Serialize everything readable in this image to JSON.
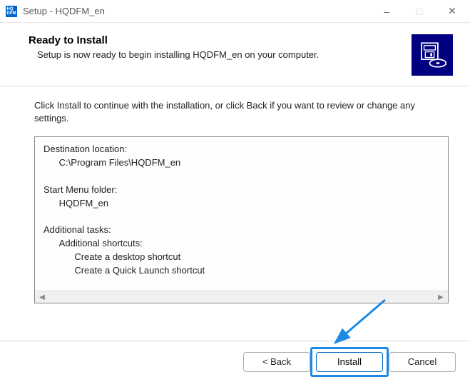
{
  "titlebar": {
    "icon_text": "HQ DFM",
    "title": "Setup - HQDFM_en"
  },
  "header": {
    "title": "Ready to Install",
    "subtitle": "Setup is now ready to begin installing HQDFM_en on your computer."
  },
  "instruction": "Click Install to continue with the installation, or click Back if you want to review or change any settings.",
  "summary": {
    "dest_label": "Destination location:",
    "dest_value": "C:\\Program Files\\HQDFM_en",
    "startmenu_label": "Start Menu folder:",
    "startmenu_value": "HQDFM_en",
    "tasks_label": "Additional tasks:",
    "tasks_sub": "Additional shortcuts:",
    "task1": "Create a desktop shortcut",
    "task2": "Create a Quick Launch shortcut"
  },
  "buttons": {
    "back": "< Back",
    "install": "Install",
    "cancel": "Cancel"
  }
}
